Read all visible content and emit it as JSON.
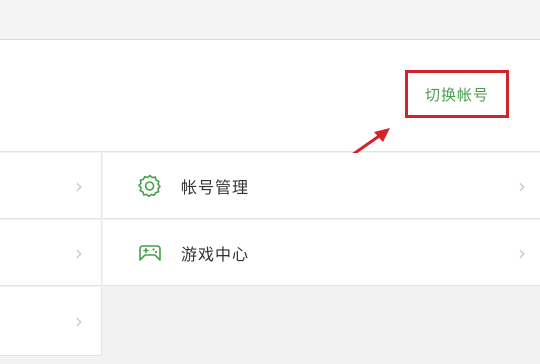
{
  "account": {
    "switch_account_label": "切换帐号"
  },
  "menu": {
    "items": [
      {
        "label": "帐号管理",
        "icon": "gear-icon"
      },
      {
        "label": "游戏中心",
        "icon": "gamepad-icon"
      }
    ]
  },
  "icons": {
    "chevron": "›"
  },
  "colors": {
    "accent_green": "#43a14c",
    "highlight_red": "#d2232a",
    "chevron_gray": "#c9c9c9"
  }
}
